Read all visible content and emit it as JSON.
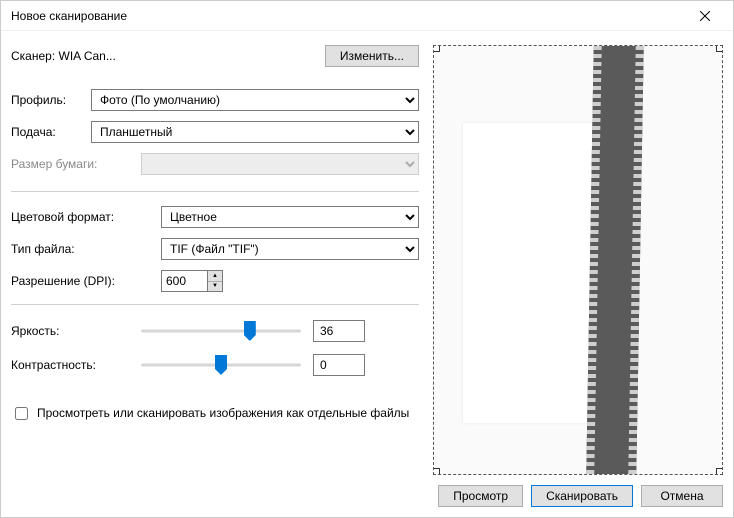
{
  "window": {
    "title": "Новое сканирование"
  },
  "scanner": {
    "label": "Сканер: WIA Can...",
    "change_btn": "Изменить..."
  },
  "profile": {
    "label": "Профиль:",
    "value": "Фото (По умолчанию)"
  },
  "feed": {
    "label": "Подача:",
    "value": "Планшетный"
  },
  "paper_size": {
    "label": "Размер бумаги:",
    "value": ""
  },
  "color_format": {
    "label": "Цветовой формат:",
    "value": "Цветное"
  },
  "file_type": {
    "label": "Тип файла:",
    "value": "TIF (Файл \"TIF\")"
  },
  "resolution": {
    "label": "Разрешение (DPI):",
    "value": "600"
  },
  "brightness": {
    "label": "Яркость:",
    "value": "36",
    "percent": 68
  },
  "contrast": {
    "label": "Контрастность:",
    "value": "0",
    "percent": 50
  },
  "separate_files": {
    "label": "Просмотреть или сканировать изображения как отдельные файлы"
  },
  "buttons": {
    "preview": "Просмотр",
    "scan": "Сканировать",
    "cancel": "Отмена"
  }
}
